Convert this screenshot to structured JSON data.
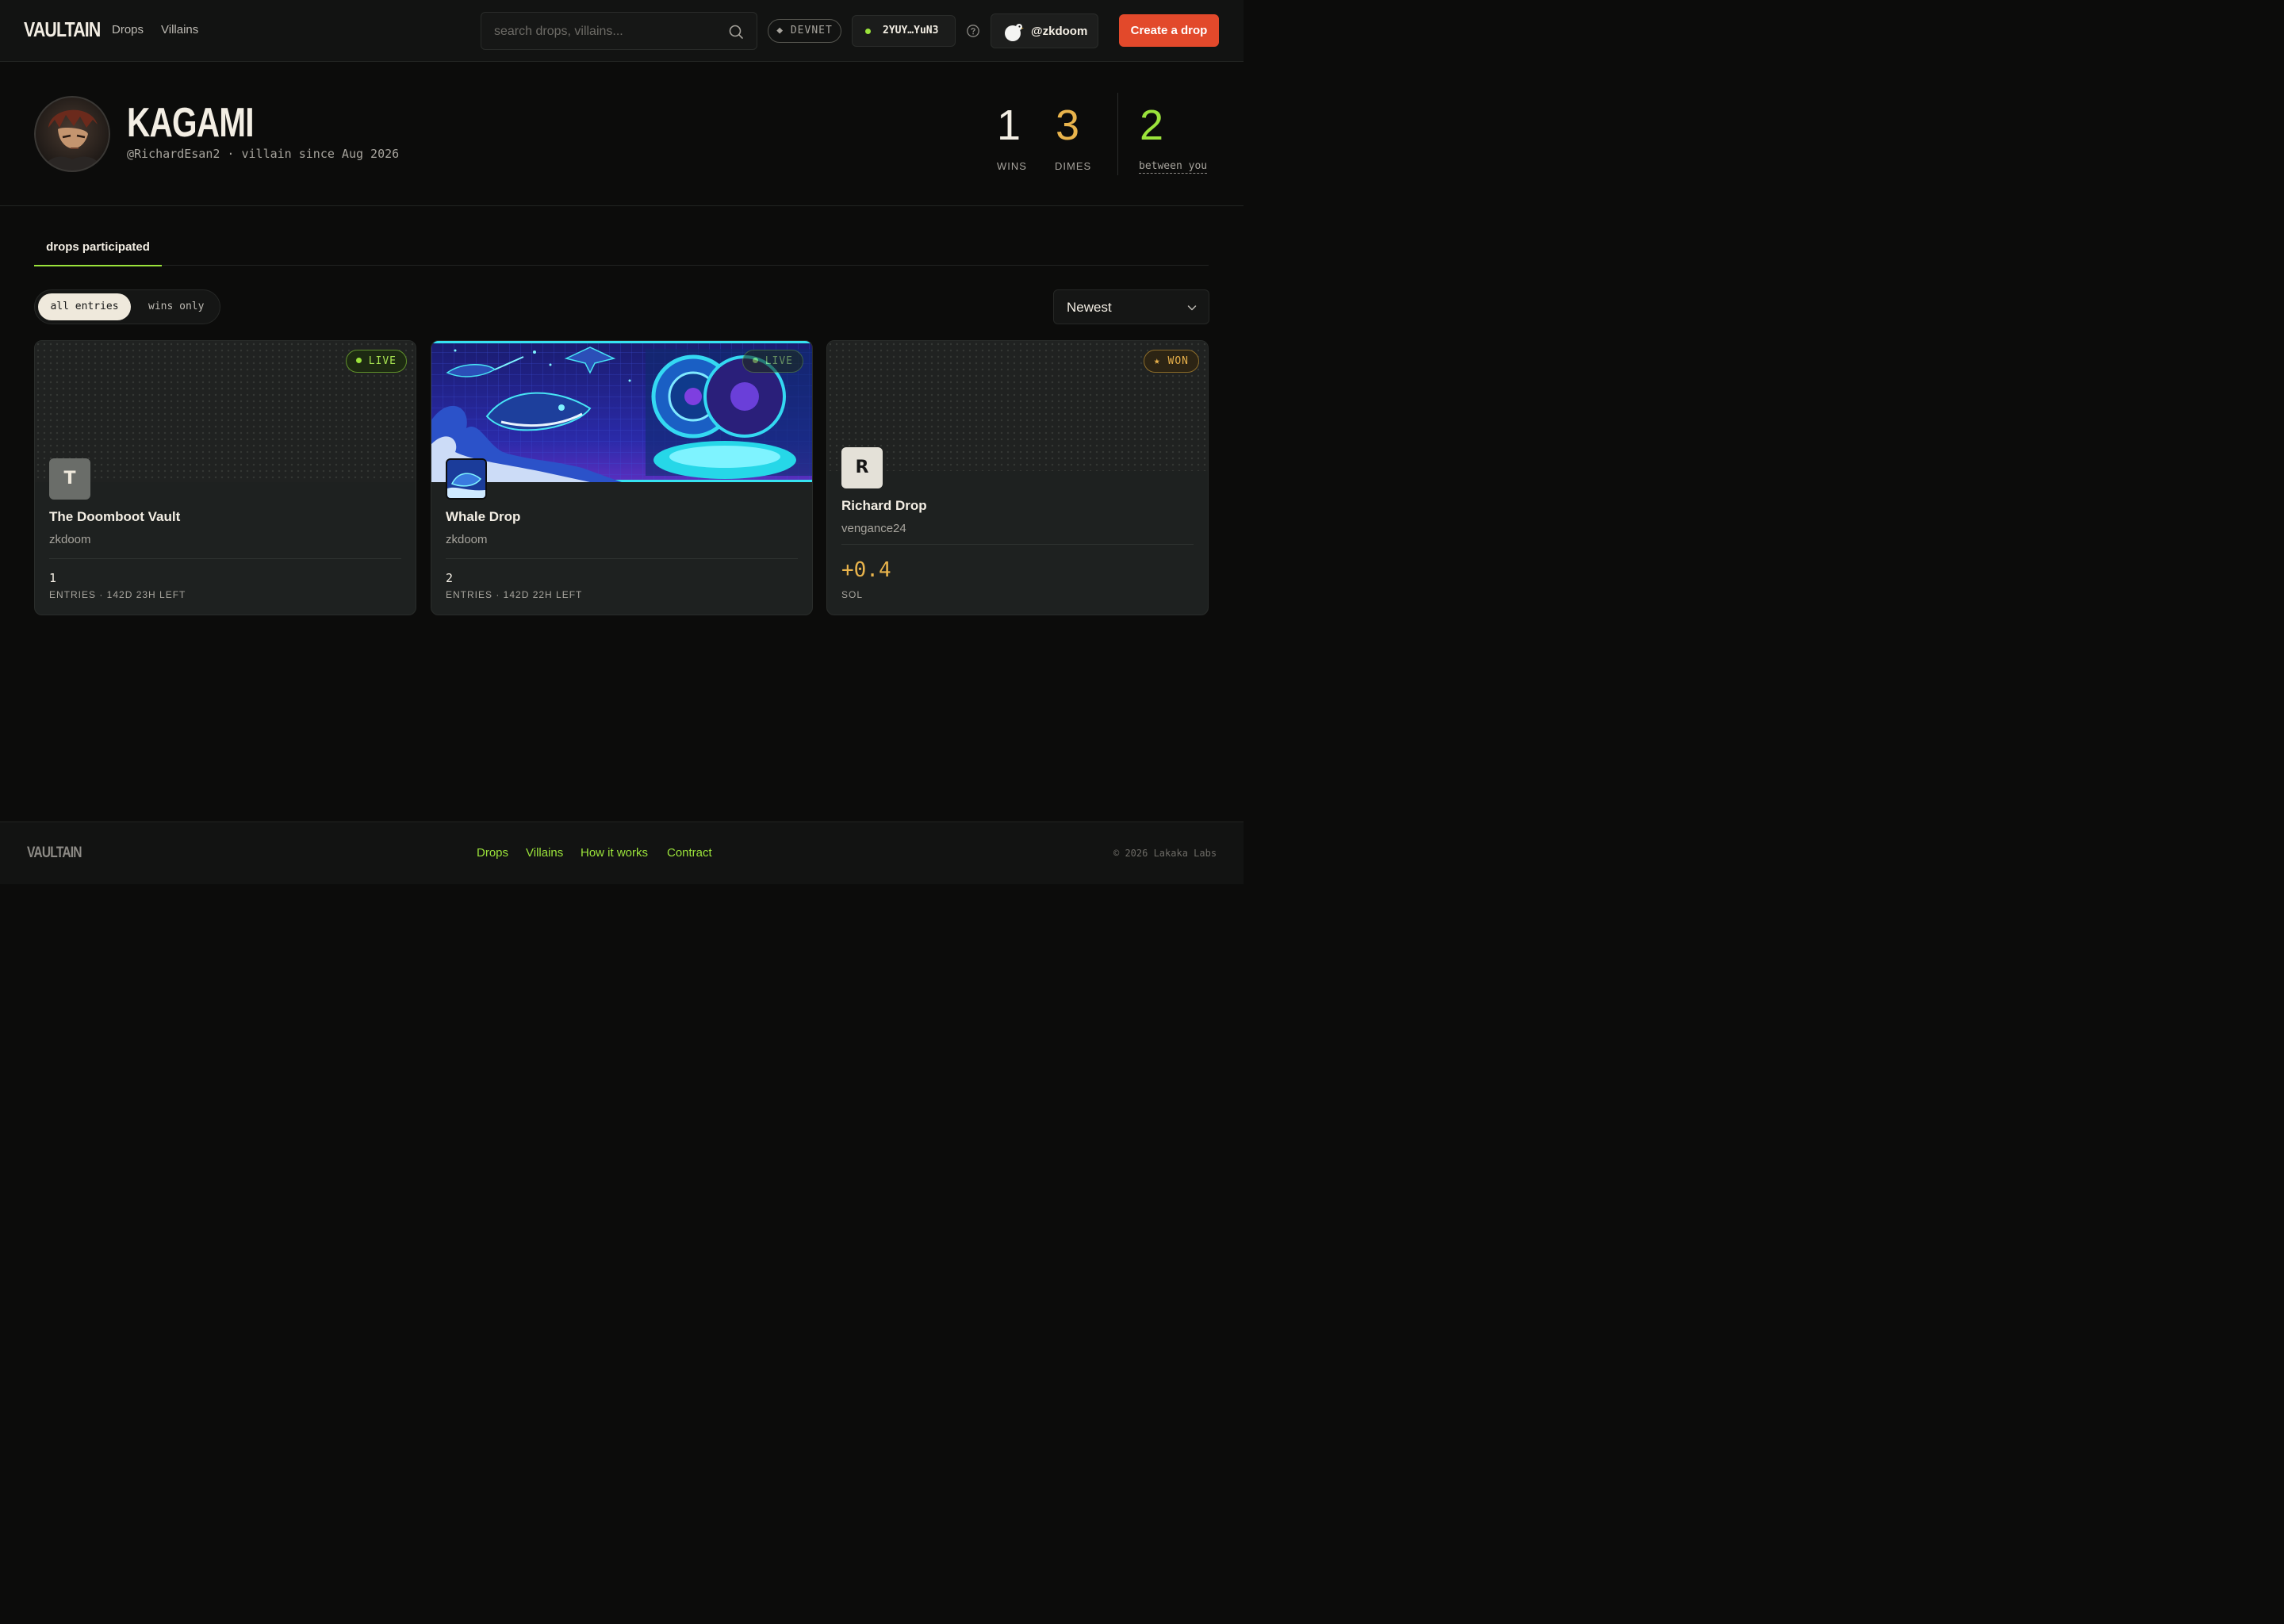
{
  "header": {
    "logo": "VAULTAIN",
    "nav": [
      "Drops",
      "Villains"
    ],
    "search_placeholder": "search drops, villains...",
    "network": "◆ DEVNET",
    "wallet_address": "2YUY…YuN3",
    "username": "@zkdoom",
    "create_label": "Create a drop"
  },
  "profile": {
    "name": "KAGAMI",
    "handle_line": "@RichardEsan2 · villain since Aug 2026",
    "stats": {
      "wins": {
        "value": "1",
        "label": "WINS"
      },
      "dimes": {
        "value": "3",
        "label": "DIMES"
      },
      "between": {
        "value": "2",
        "label": "between you"
      }
    }
  },
  "tabs": {
    "active": "drops participated"
  },
  "filters": {
    "options": [
      "all entries",
      "wins only"
    ],
    "sort_value": "Newest"
  },
  "cards": [
    {
      "title": "The Doomboot Vault",
      "creator": "zkdoom",
      "badge": "LIVE",
      "thumb_letter": "T",
      "metric": "1",
      "metric_label": "ENTRIES · 142D 23H LEFT"
    },
    {
      "title": "Whale Drop",
      "creator": "zkdoom",
      "badge": "LIVE",
      "metric": "2",
      "metric_label": "ENTRIES · 142D 22H LEFT"
    },
    {
      "title": "Richard Drop",
      "creator": "vengance24",
      "badge": "★ WON",
      "thumb_letter": "R",
      "metric": "+0.4",
      "metric_label": "SOL"
    }
  ],
  "footer": {
    "logo": "VAULTAIN",
    "links": [
      "Drops",
      "Villains",
      "How it works",
      "Contract"
    ],
    "copyright": "© 2026 Lakaka Labs"
  },
  "colors": {
    "accent_green": "#9be33b",
    "accent_orange": "#e2492b",
    "dimes_gold": "#e9b44c",
    "background": "#0c0c0b"
  }
}
